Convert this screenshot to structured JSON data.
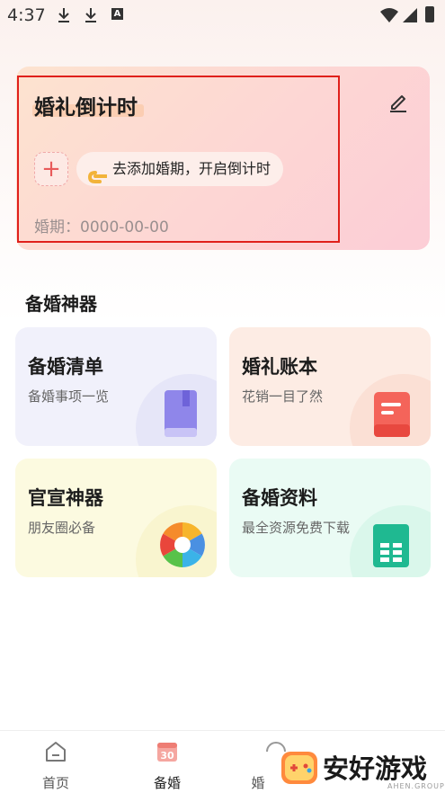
{
  "status_bar": {
    "time": "4:37",
    "a_badge": "A"
  },
  "wedding_card": {
    "title": "婚礼倒计时",
    "add_symbol": "+",
    "hint": "去添加婚期，开启倒计时",
    "hand_emoji": "👈",
    "date_label": "婚期：0000-00-00"
  },
  "section_title": "备婚神器",
  "tools": [
    {
      "title": "备婚清单",
      "subtitle": "备婚事项一览",
      "icon": "book-icon"
    },
    {
      "title": "婚礼账本",
      "subtitle": "花销一目了然",
      "icon": "ledger-icon"
    },
    {
      "title": "官宣神器",
      "subtitle": "朋友圈必备",
      "icon": "camera-aperture-icon"
    },
    {
      "title": "备婚资料",
      "subtitle": "最全资源免费下载",
      "icon": "spreadsheet-icon"
    }
  ],
  "nav": {
    "items": [
      {
        "label": "首页",
        "icon": "home-icon"
      },
      {
        "label": "备婚",
        "icon": "calendar-icon"
      },
      {
        "label": "婚",
        "icon": "ring-icon"
      }
    ],
    "calendar_day": "30"
  },
  "watermark": {
    "text": "安好游戏",
    "sub": "AHEN.GROUP"
  },
  "colors": {
    "accent_red": "#e0201b",
    "card_pink": "#fdd6d4"
  }
}
